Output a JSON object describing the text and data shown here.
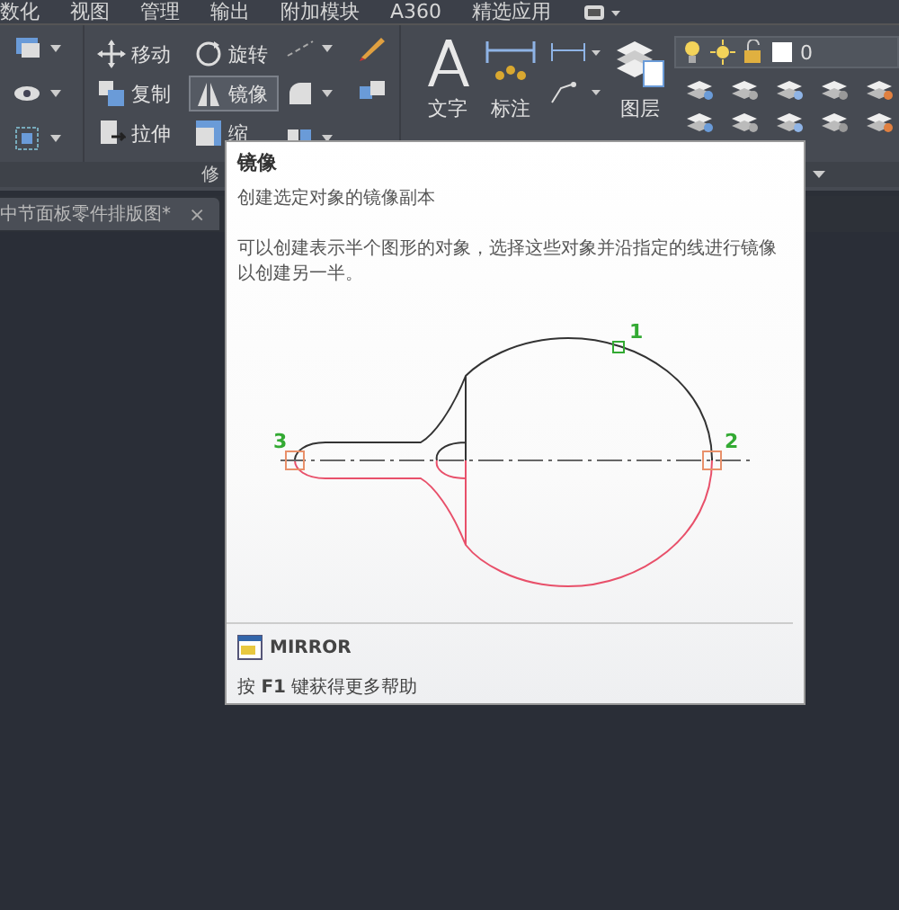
{
  "menu": [
    {
      "label": "数化"
    },
    {
      "label": "视图"
    },
    {
      "label": "管理"
    },
    {
      "label": "输出"
    },
    {
      "label": "附加模块"
    },
    {
      "label": "A360"
    },
    {
      "label": "精选应用"
    }
  ],
  "modify_tools": [
    {
      "label": "移动",
      "selected": false
    },
    {
      "label": "旋转",
      "selected": false
    },
    {
      "label": "复制",
      "selected": false
    },
    {
      "label": "镜像",
      "selected": true
    },
    {
      "label": "拉伸",
      "selected": false
    },
    {
      "label": "缩",
      "selected": false
    }
  ],
  "panel_title": "修",
  "large_tools": [
    {
      "label": "文字",
      "kind": "text"
    },
    {
      "label": "标注",
      "kind": "dimension"
    },
    {
      "label": "图层",
      "kind": "layer"
    }
  ],
  "layer_combo": {
    "value": "0"
  },
  "file_tab": {
    "label": "中节面板零件排版图*",
    "close": "×"
  },
  "tooltip": {
    "title": "镜像",
    "summary": "创建选定对象的镜像副本",
    "description": "可以创建表示半个图形的对象，选择这些对象并沿指定的线进行镜像以创建另一半。",
    "points": [
      "1",
      "2",
      "3"
    ],
    "command": "MIRROR",
    "help": "按 **F1** 键获得更多帮助"
  }
}
